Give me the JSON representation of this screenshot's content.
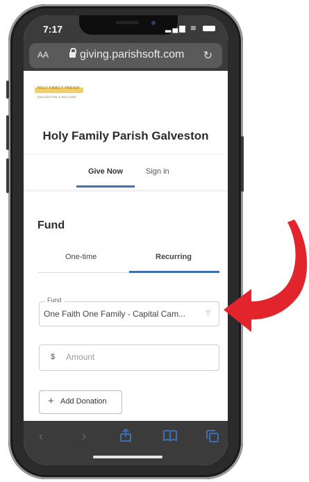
{
  "status_bar": {
    "time": "7:17"
  },
  "browser": {
    "text_size_label": "AA",
    "url": "giving.parishsoft.com"
  },
  "page": {
    "parish_name": "Holy Family Parish Galveston",
    "logo_text_top": "HOLY FAMILY PARISH",
    "logo_text_bottom": "GALVESTON & BOLIVAR",
    "tabs": [
      {
        "label": "Give Now"
      },
      {
        "label": "Sign in"
      }
    ],
    "section_title": "Fund",
    "frequency": [
      {
        "label": "One-time"
      },
      {
        "label": "Recurring"
      }
    ],
    "fund_field": {
      "label": "Fund",
      "value": "One Faith One Family - Capital Cam..."
    },
    "amount_field": {
      "currency": "$",
      "placeholder": "Amount"
    },
    "add_donation_label": "Add Donation"
  },
  "colors": {
    "accent": "#3f6fb2",
    "arrow": "#e2252d",
    "chrome": "#3b3b3b"
  },
  "icons": [
    "lock-icon",
    "reload-icon",
    "chevron-down-icon",
    "plus-icon",
    "back-icon",
    "forward-icon",
    "share-icon",
    "bookmarks-icon",
    "tabs-icon"
  ]
}
